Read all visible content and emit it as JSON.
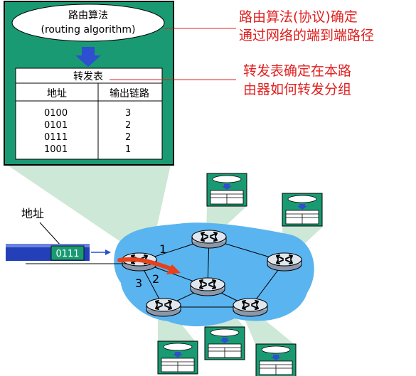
{
  "router_box": {
    "algorithm_line1": "路由算法",
    "algorithm_line2": "(routing algorithm)",
    "table_title": "转发表",
    "col_address": "地址",
    "col_link": "输出链路",
    "rows": [
      {
        "address": "0100",
        "link": "3"
      },
      {
        "address": "0101",
        "link": "2"
      },
      {
        "address": "0111",
        "link": "2"
      },
      {
        "address": "1001",
        "link": "1"
      }
    ]
  },
  "notes": {
    "algorithm_note_line1": "路由算法(协议)确定",
    "algorithm_note_line2": "通过网络的端到端路径",
    "table_note_line1": "转发表确定在本路",
    "table_note_line2": "由器如何转发分组"
  },
  "packet": {
    "label": "地址",
    "header_value": "0111"
  },
  "links": {
    "link1": "1",
    "link2": "2",
    "link3": "3"
  },
  "colors": {
    "router_box_bg": "#1a9a72",
    "network_blue": "#5ab4f0",
    "beam_green": "#cde8d6",
    "note_red": "#e02020",
    "arrow_blue": "#2d4fd0",
    "forward_arrow_red": "#e8401a"
  }
}
